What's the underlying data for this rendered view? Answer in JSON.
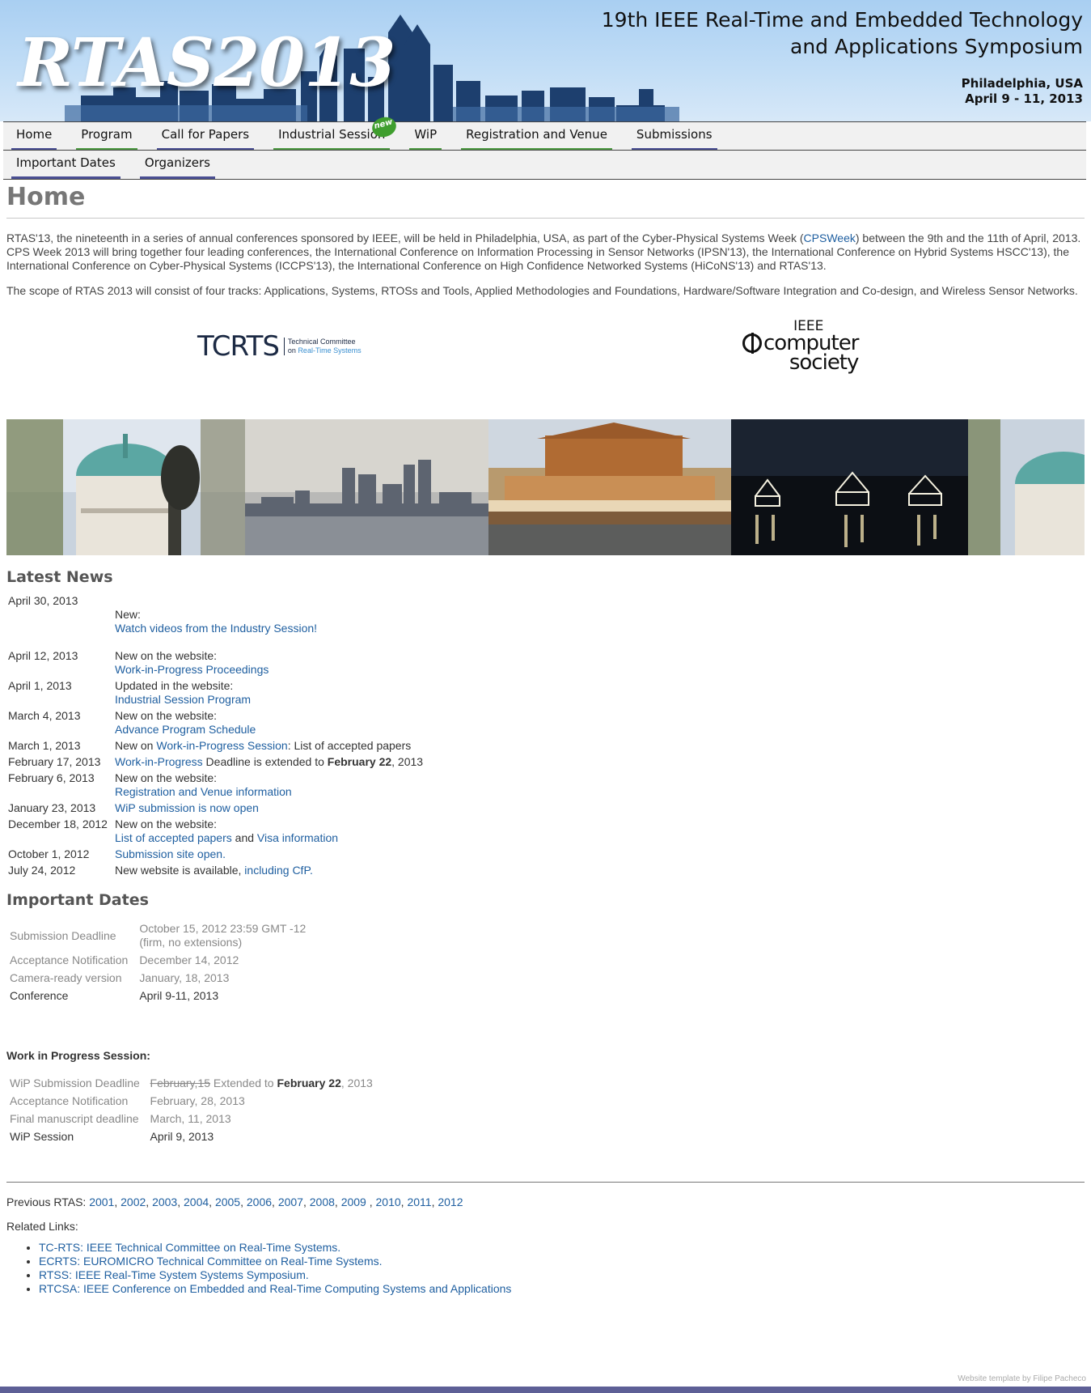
{
  "header": {
    "logo_text": "RTAS2013",
    "title_line1": "19th IEEE Real-Time and Embedded Technology",
    "title_line2": "and Applications Symposium",
    "location": "Philadelphia, USA",
    "dates": "April 9 - 11, 2013"
  },
  "nav": {
    "row1": [
      {
        "label": "Home",
        "accent": "blue"
      },
      {
        "label": "Program",
        "accent": "green"
      },
      {
        "label": "Call for Papers",
        "accent": "blue"
      },
      {
        "label": "Industrial Session",
        "accent": "green",
        "badge": "new"
      },
      {
        "label": "WiP",
        "accent": "green"
      },
      {
        "label": "Registration and Venue",
        "accent": "green"
      },
      {
        "label": "Submissions",
        "accent": "blue"
      }
    ],
    "row2": [
      {
        "label": "Important Dates",
        "accent": "blue"
      },
      {
        "label": "Organizers",
        "accent": "blue"
      }
    ]
  },
  "page": {
    "title": "Home",
    "intro1_a": "RTAS'13, the nineteenth in a series of annual conferences sponsored by IEEE, will be held in Philadelphia, USA, as part of the Cyber-Physical Systems Week (",
    "intro1_link": "CPSWeek",
    "intro1_b": ") between the 9th and the 11th of April, 2013. CPS Week 2013 will bring together four leading conferences, the International Conference on Information Processing in Sensor Networks (IPSN'13), the International Conference on Hybrid Systems HSCC'13), the International Conference on Cyber-Physical Systems (ICCPS'13), the International Conference on High Confidence Networked Systems (HiCoNS'13) and RTAS'13.",
    "intro2": "The scope of RTAS 2013 will consist of four tracks: Applications, Systems, RTOSs and Tools, Applied Methodologies and Foundations, Hardware/Software Integration and Co-design, and Wireless Sensor Networks."
  },
  "logos": {
    "tcrts_main": "TCRTS",
    "tcrts_line1": "Technical Committee",
    "tcrts_line2a": "on ",
    "tcrts_line2b": "Real-Time Systems",
    "ieee_top": "IEEE",
    "ieee_mid": "computer",
    "ieee_bot": "society"
  },
  "news": {
    "heading": "Latest News",
    "items": [
      {
        "date": "April 30, 2013",
        "text1": "New:",
        "link1": "Watch videos from the Industry Session!"
      },
      {
        "date": "April 12, 2013",
        "text1": "New on the website:",
        "link1": "Work-in-Progress Proceedings"
      },
      {
        "date": "April 1, 2013",
        "text1": "Updated in the website:",
        "link1": "Industrial Session Program"
      },
      {
        "date": "March 4, 2013",
        "text1": "New on the website:",
        "link1": "Advance Program Schedule"
      },
      {
        "date": "March 1, 2013",
        "pre": "New on ",
        "link1": "Work-in-Progress Session",
        "post": ": List of accepted papers"
      },
      {
        "date": "February 17, 2013",
        "link1": "Work-in-Progress",
        "post": " Deadline is extended to ",
        "bold": "February 22",
        "post2": ", 2013"
      },
      {
        "date": "February 6, 2013",
        "text1": "New on the website:",
        "link1": "Registration and Venue information"
      },
      {
        "date": "January 23, 2013",
        "link1": "WiP submission is now open"
      },
      {
        "date": "December 18, 2012",
        "text1": "New on the website:",
        "link1": "List of accepted papers",
        "mid": " and ",
        "link2": "Visa information"
      },
      {
        "date": "October 1, 2012",
        "link1": "Submission site open."
      },
      {
        "date": "July 24, 2012",
        "pre": "New website is available, ",
        "link1": "including CfP."
      }
    ]
  },
  "important_dates": {
    "heading": "Important Dates",
    "rows": [
      {
        "label": "Submission Deadline",
        "value": "October 15, 2012 23:59 GMT -12",
        "value2": "(firm, no extensions)"
      },
      {
        "label": "Acceptance Notification",
        "value": "December 14, 2012"
      },
      {
        "label": "Camera-ready version",
        "value": "January, 18, 2013"
      },
      {
        "label": "Conference",
        "value": "April 9-11, 2013"
      }
    ]
  },
  "wip": {
    "heading": "Work in Progress Session:",
    "deadline_label": "WiP Submission Deadline",
    "deadline_struck": "February,15",
    "deadline_ext": " Extended to ",
    "deadline_bold": "February 22",
    "deadline_year": ", 2013",
    "rows": [
      {
        "label": "Acceptance Notification",
        "value": "February, 28, 2013"
      },
      {
        "label": "Final manuscript deadline",
        "value": "March, 11, 2013"
      },
      {
        "label": "WiP Session",
        "value": "April 9, 2013"
      }
    ]
  },
  "footer": {
    "previous_label": "Previous RTAS: ",
    "years": [
      "2001",
      "2002",
      "2003",
      "2004",
      "2005",
      "2006",
      "2007",
      "2008",
      "2009 ",
      "2010",
      "2011",
      "2012"
    ],
    "related_label": "Related Links:",
    "related": [
      "TC-RTS: IEEE Technical Committee on Real-Time Systems.",
      "ECRTS: EUROMICRO Technical Committee on Real-Time Systems.",
      "RTSS: IEEE Real-Time System Systems Symposium.",
      "RTCSA: IEEE Conference on Embedded and Real-Time Computing Systems and Applications"
    ],
    "credit": "Website template by Filipe Pacheco"
  },
  "colors": {
    "link": "#1f5fa0",
    "nav_blue": "#4a4f93",
    "nav_green": "#4e9a43",
    "bottom_bar": "#5d5f96"
  }
}
